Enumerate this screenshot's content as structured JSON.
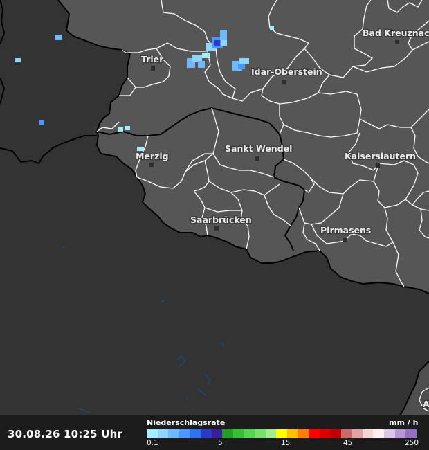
{
  "map": {
    "cities": [
      {
        "name": "Trier"
      },
      {
        "name": "Idar-Oberstein"
      },
      {
        "name": "Bad Kreuznach"
      },
      {
        "name": "Merzig"
      },
      {
        "name": "Sankt Wendel"
      },
      {
        "name": "Kaiserslautern"
      },
      {
        "name": "Saarbrücken"
      },
      {
        "name": "Pirmasens"
      }
    ]
  },
  "footer": {
    "timestamp": "30.08.26 10:25 Uhr",
    "legend_title": "Niederschlagsrate",
    "legend_unit": "mm / h",
    "legend_ticks": [
      "0.1",
      "5",
      "15",
      "45",
      "250"
    ],
    "legend_colors": [
      "#a6ecff",
      "#8fd4ff",
      "#6fb7ff",
      "#4d96ff",
      "#2f72ef",
      "#2c3ac9",
      "#3a1e9e",
      "#22a024",
      "#37bf35",
      "#56d450",
      "#7ae06c",
      "#a0ec8e",
      "#ffff00",
      "#ffc000",
      "#ff7d00",
      "#ff0000",
      "#de0000",
      "#c00000",
      "#c96a6a",
      "#e3a2a2",
      "#f6d5d5",
      "#fff0f0",
      "#dcc6e8",
      "#b796d6",
      "#9470c2"
    ]
  },
  "colors": {
    "outside_area": "#333333",
    "inside_area": "#565656",
    "border": "#000000",
    "district_line": "#ffffff"
  }
}
